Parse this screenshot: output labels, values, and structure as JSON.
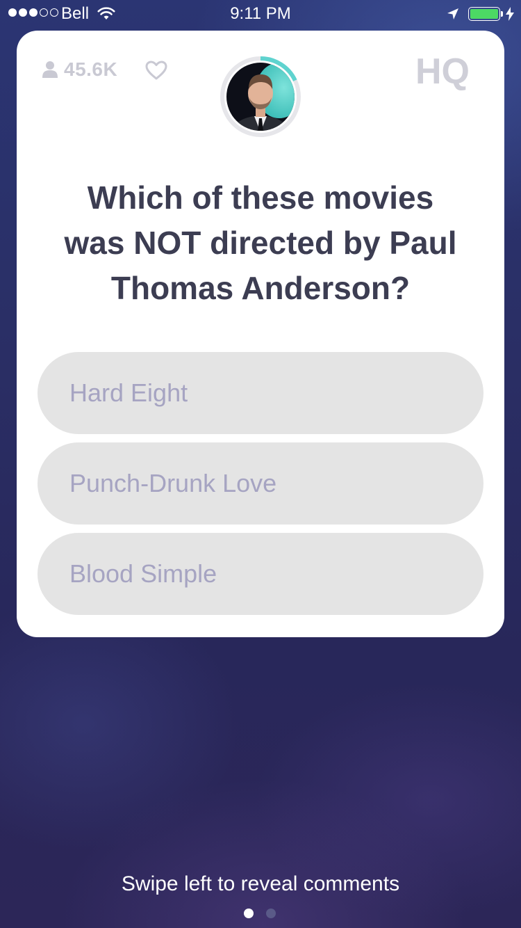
{
  "status_bar": {
    "signal_bars_filled": 3,
    "signal_bars_total": 5,
    "carrier": "Bell",
    "time": "9:11 PM",
    "battery_level": 1.0,
    "battery_color": "#4cd964",
    "icons": [
      "wifi-icon",
      "location-arrow-icon",
      "battery-icon",
      "charging-bolt-icon"
    ]
  },
  "header": {
    "viewer_count": "45.6K",
    "viewer_icon": "person-icon",
    "like_icon": "heart-icon",
    "logo": "HQ",
    "countdown_progress": 0.18,
    "countdown_color": "#5fd3cf"
  },
  "question": {
    "line1": "Which of these movies",
    "line2": "was NOT directed by Paul",
    "line3": "Thomas Anderson?"
  },
  "answers": [
    {
      "label": "Hard Eight"
    },
    {
      "label": "Punch-Drunk Love"
    },
    {
      "label": "Blood Simple"
    }
  ],
  "footer": {
    "hint": "Swipe left to reveal comments",
    "pages_total": 2,
    "active_page": 1
  }
}
